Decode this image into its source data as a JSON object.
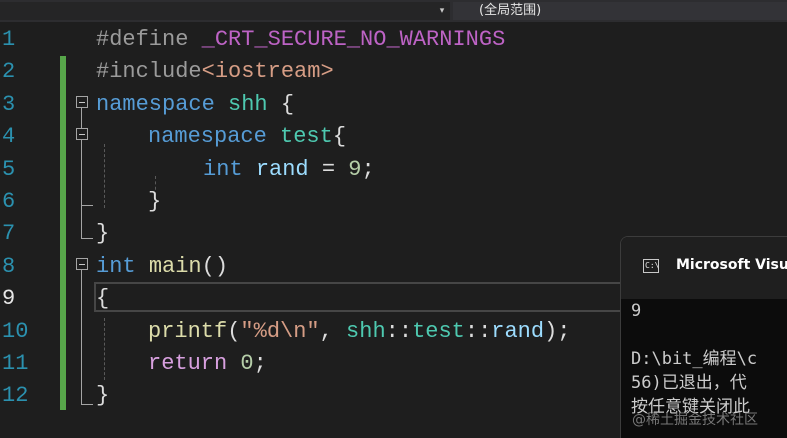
{
  "toolbar": {
    "scope_label": "(全局范围)",
    "dropdown_arrow": "▾"
  },
  "editor": {
    "line_numbers": [
      "1",
      "2",
      "3",
      "4",
      "5",
      "6",
      "7",
      "8",
      "9",
      "10",
      "11",
      "12"
    ],
    "current_line": "9",
    "lines": [
      {
        "parts": [
          [
            "pp",
            "#define "
          ],
          [
            "mac",
            "_CRT_SECURE_NO_WARNINGS"
          ]
        ]
      },
      {
        "parts": [
          [
            "pp",
            "#include"
          ],
          [
            "hdr",
            "<iostream>"
          ]
        ]
      },
      {
        "parts": [
          [
            "kw",
            "namespace"
          ],
          [
            "id",
            " "
          ],
          [
            "ns",
            "shh"
          ],
          [
            "id",
            " {"
          ]
        ]
      },
      {
        "parts": [
          [
            "kw",
            "namespace"
          ],
          [
            "id",
            " "
          ],
          [
            "ns",
            "test"
          ],
          [
            "id",
            "{"
          ]
        ]
      },
      {
        "parts": [
          [
            "kw",
            "int"
          ],
          [
            "id",
            " "
          ],
          [
            "var",
            "rand"
          ],
          [
            "id",
            " = "
          ],
          [
            "num",
            "9"
          ],
          [
            "id",
            ";"
          ]
        ]
      },
      {
        "parts": [
          [
            "id",
            "}"
          ]
        ]
      },
      {
        "parts": [
          [
            "id",
            "}"
          ]
        ]
      },
      {
        "parts": [
          [
            "kw",
            "int"
          ],
          [
            "id",
            " "
          ],
          [
            "fn",
            "main"
          ],
          [
            "id",
            "()"
          ]
        ]
      },
      {
        "parts": [
          [
            "id",
            "{"
          ]
        ]
      },
      {
        "parts": [
          [
            "fn",
            "printf"
          ],
          [
            "id",
            "("
          ],
          [
            "str",
            "\"%d\\n\""
          ],
          [
            "id",
            ", "
          ],
          [
            "ns",
            "shh"
          ],
          [
            "id",
            "::"
          ],
          [
            "ns",
            "test"
          ],
          [
            "id",
            "::"
          ],
          [
            "var",
            "rand"
          ],
          [
            "id",
            ");"
          ]
        ]
      },
      {
        "parts": [
          [
            "ctl",
            "return"
          ],
          [
            "id",
            " "
          ],
          [
            "num",
            "0"
          ],
          [
            "id",
            ";"
          ]
        ]
      },
      {
        "parts": [
          [
            "id",
            "}"
          ]
        ]
      }
    ]
  },
  "console": {
    "title": "Microsoft Visual",
    "icon": "C:\\",
    "output": [
      "9",
      "",
      "D:\\bit_编程\\c",
      "56)已退出，代",
      "按任意键关闭此"
    ]
  },
  "watermark": "@稀土掘金技术社区"
}
